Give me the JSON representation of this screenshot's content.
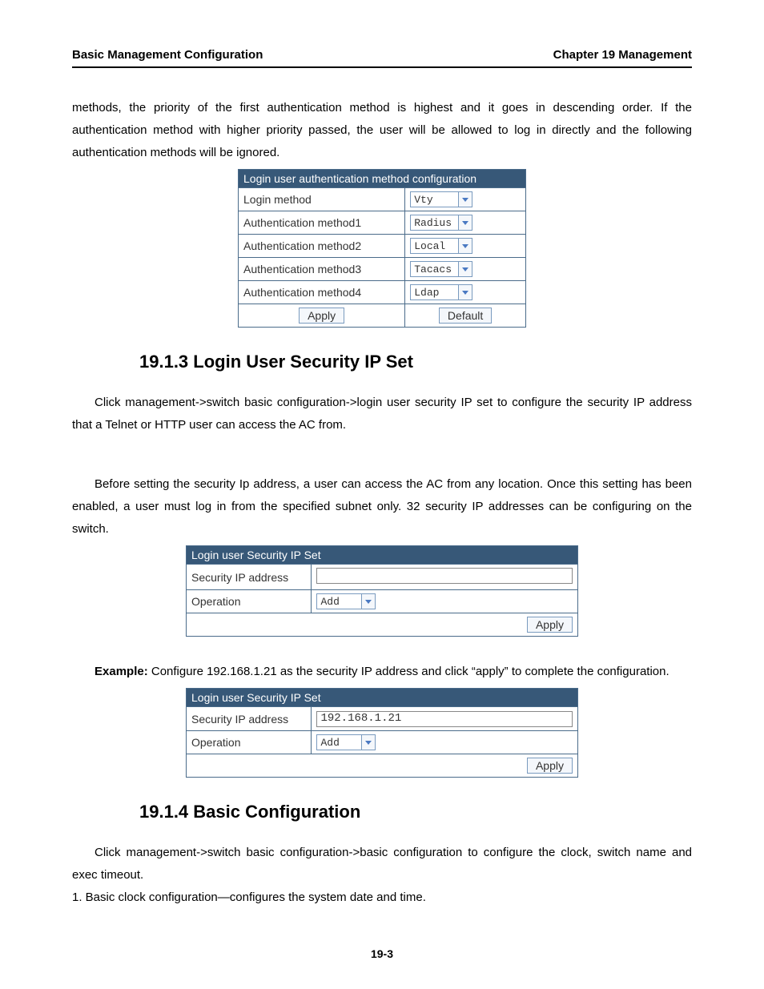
{
  "header": {
    "left": "Basic Management Configuration",
    "right": "Chapter 19 Management"
  },
  "para_intro": "methods, the priority of the first authentication method is highest and it goes in descending order. If the authentication method with higher priority passed, the user will be allowed to log in directly and the following authentication methods will be ignored.",
  "auth_table": {
    "title": "Login user authentication method configuration",
    "rows": [
      {
        "label": "Login method",
        "value": "Vty"
      },
      {
        "label": "Authentication method1",
        "value": "Radius"
      },
      {
        "label": "Authentication method2",
        "value": "Local"
      },
      {
        "label": "Authentication method3",
        "value": "Tacacs"
      },
      {
        "label": "Authentication method4",
        "value": "Ldap"
      }
    ],
    "apply": "Apply",
    "default": "Default"
  },
  "sec_1913": {
    "title": "19.1.3 Login User Security IP Set",
    "para1": "Click management->switch basic configuration->login user security IP set to configure the security IP address that a Telnet or HTTP user can access the AC from.",
    "para2": "Before setting the security Ip address, a user can access the AC from any location. Once this setting has been enabled, a user must log in from the specified subnet only. 32 security IP addresses can be configuring on the switch."
  },
  "ip_table_a": {
    "title": "Login user Security IP Set",
    "row1_label": "Security IP address",
    "row1_value": "",
    "row2_label": "Operation",
    "row2_value": "Add",
    "apply": "Apply"
  },
  "example_lead": "Example:",
  "example_rest": " Configure 192.168.1.21 as the security IP address and click “apply” to complete the configuration.",
  "ip_table_b": {
    "title": "Login user Security IP Set",
    "row1_label": "Security IP address",
    "row1_value": "192.168.1.21",
    "row2_label": "Operation",
    "row2_value": "Add",
    "apply": "Apply"
  },
  "sec_1914": {
    "title": "19.1.4 Basic Configuration",
    "para1": "Click management->switch basic configuration->basic configuration to configure the clock, switch name and exec timeout.",
    "para2": "1. Basic clock configuration—configures the system date and time."
  },
  "page_num": "19-3"
}
